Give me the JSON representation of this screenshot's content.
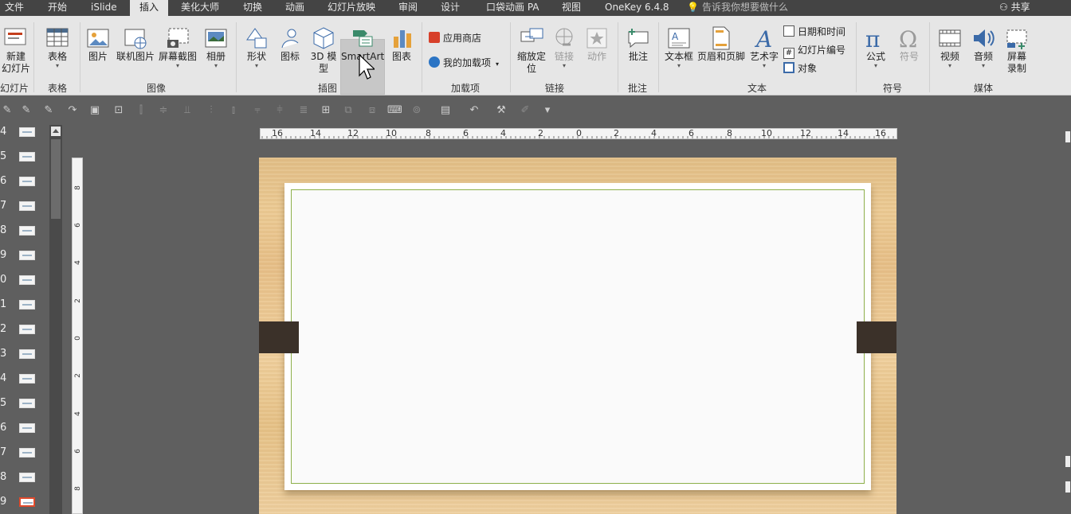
{
  "menu": {
    "items": [
      "文件",
      "开始",
      "iSlide",
      "插入",
      "美化大师",
      "切换",
      "动画",
      "幻灯片放映",
      "审阅",
      "设计",
      "口袋动画 PA",
      "视图",
      "OneKey 6.4.8"
    ],
    "tell_me": "告诉我你想要做什么",
    "share": "共享"
  },
  "ribbon": {
    "groups": {
      "slides": "幻灯片",
      "tables": "表格",
      "images": "图像",
      "illustrations": "插图",
      "addins": "加载项",
      "links": "链接",
      "comments": "批注",
      "text": "文本",
      "symbols": "符号",
      "media": "媒体"
    },
    "buttons": {
      "new_slide_1": "新建",
      "new_slide_2": "幻灯片",
      "table": "表格",
      "picture": "图片",
      "online_picture": "联机图片",
      "screenshot": "屏幕截图",
      "album": "相册",
      "shapes": "形状",
      "icons": "图标",
      "model3d_1": "3D 模",
      "model3d_2": "型",
      "smartart": "SmartArt",
      "chart": "图表",
      "store": "应用商店",
      "my_addins": "我的加载项",
      "zoom_1": "缩放定",
      "zoom_2": "位",
      "link": "链接",
      "action": "动作",
      "comment": "批注",
      "textbox": "文本框",
      "header_footer": "页眉和页脚",
      "wordart": "艺术字",
      "date_time": "日期和时间",
      "slide_number": "幻灯片编号",
      "object": "对象",
      "equation": "公式",
      "symbol": "符号",
      "video": "视频",
      "audio": "音频",
      "screen_rec_1": "屏幕",
      "screen_rec_2": "录制"
    }
  },
  "thumbnails": [
    "4",
    "5",
    "6",
    "7",
    "8",
    "9",
    "0",
    "1",
    "2",
    "3",
    "4",
    "5",
    "6",
    "7",
    "8",
    "9"
  ],
  "ruler": {
    "h_labels": [
      "16",
      "14",
      "12",
      "10",
      "8",
      "6",
      "4",
      "2",
      "0",
      "2",
      "4",
      "6",
      "8",
      "10",
      "12",
      "14",
      "16"
    ],
    "v_labels": [
      "8",
      "6",
      "4",
      "2",
      "0",
      "2",
      "4",
      "6",
      "8"
    ]
  },
  "colors": {
    "accent": "#c43e1c",
    "paper_border": "#8db04a",
    "clip": "#3b3129",
    "wood": "#e9c68f"
  }
}
